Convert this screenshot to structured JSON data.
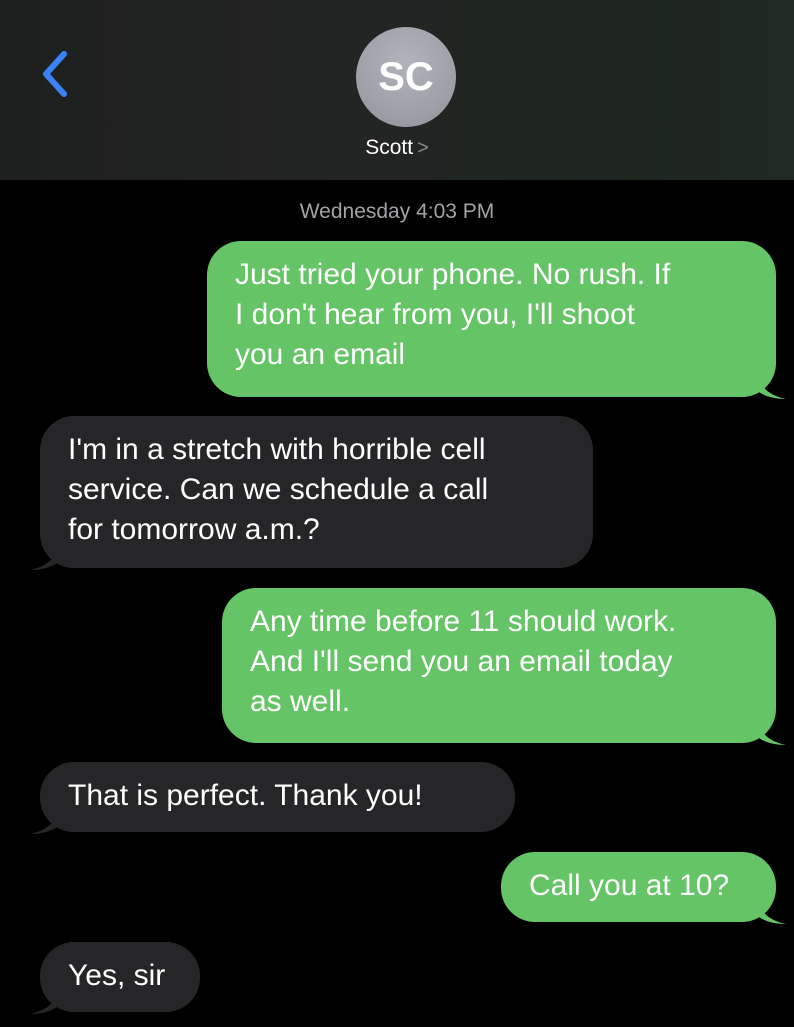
{
  "header": {
    "avatar_initials": "SC",
    "contact_name": "Scott",
    "contact_chevron": ">"
  },
  "thread": {
    "timestamp": "Wednesday 4:03 PM",
    "messages": [
      {
        "direction": "sent",
        "lines": [
          "Just tried your phone. No rush. If",
          "I don't hear from you, I'll shoot",
          "you an email"
        ]
      },
      {
        "direction": "received",
        "lines": [
          "I'm in a stretch with horrible cell",
          "service.  Can we schedule a call",
          "for tomorrow a.m.?"
        ]
      },
      {
        "direction": "sent",
        "lines": [
          "Any time before 11 should work.",
          "And I'll send you an email today",
          "as well."
        ]
      },
      {
        "direction": "received",
        "lines": [
          "That is perfect.  Thank you!"
        ]
      },
      {
        "direction": "sent",
        "lines": [
          "Call you at 10?"
        ]
      },
      {
        "direction": "received",
        "lines": [
          "Yes, sir"
        ]
      }
    ]
  },
  "colors": {
    "sent_bubble": "#65c466",
    "received_bubble": "#262628",
    "accent": "#3b82f6"
  },
  "icons": {
    "back": "chevron-left-icon"
  }
}
